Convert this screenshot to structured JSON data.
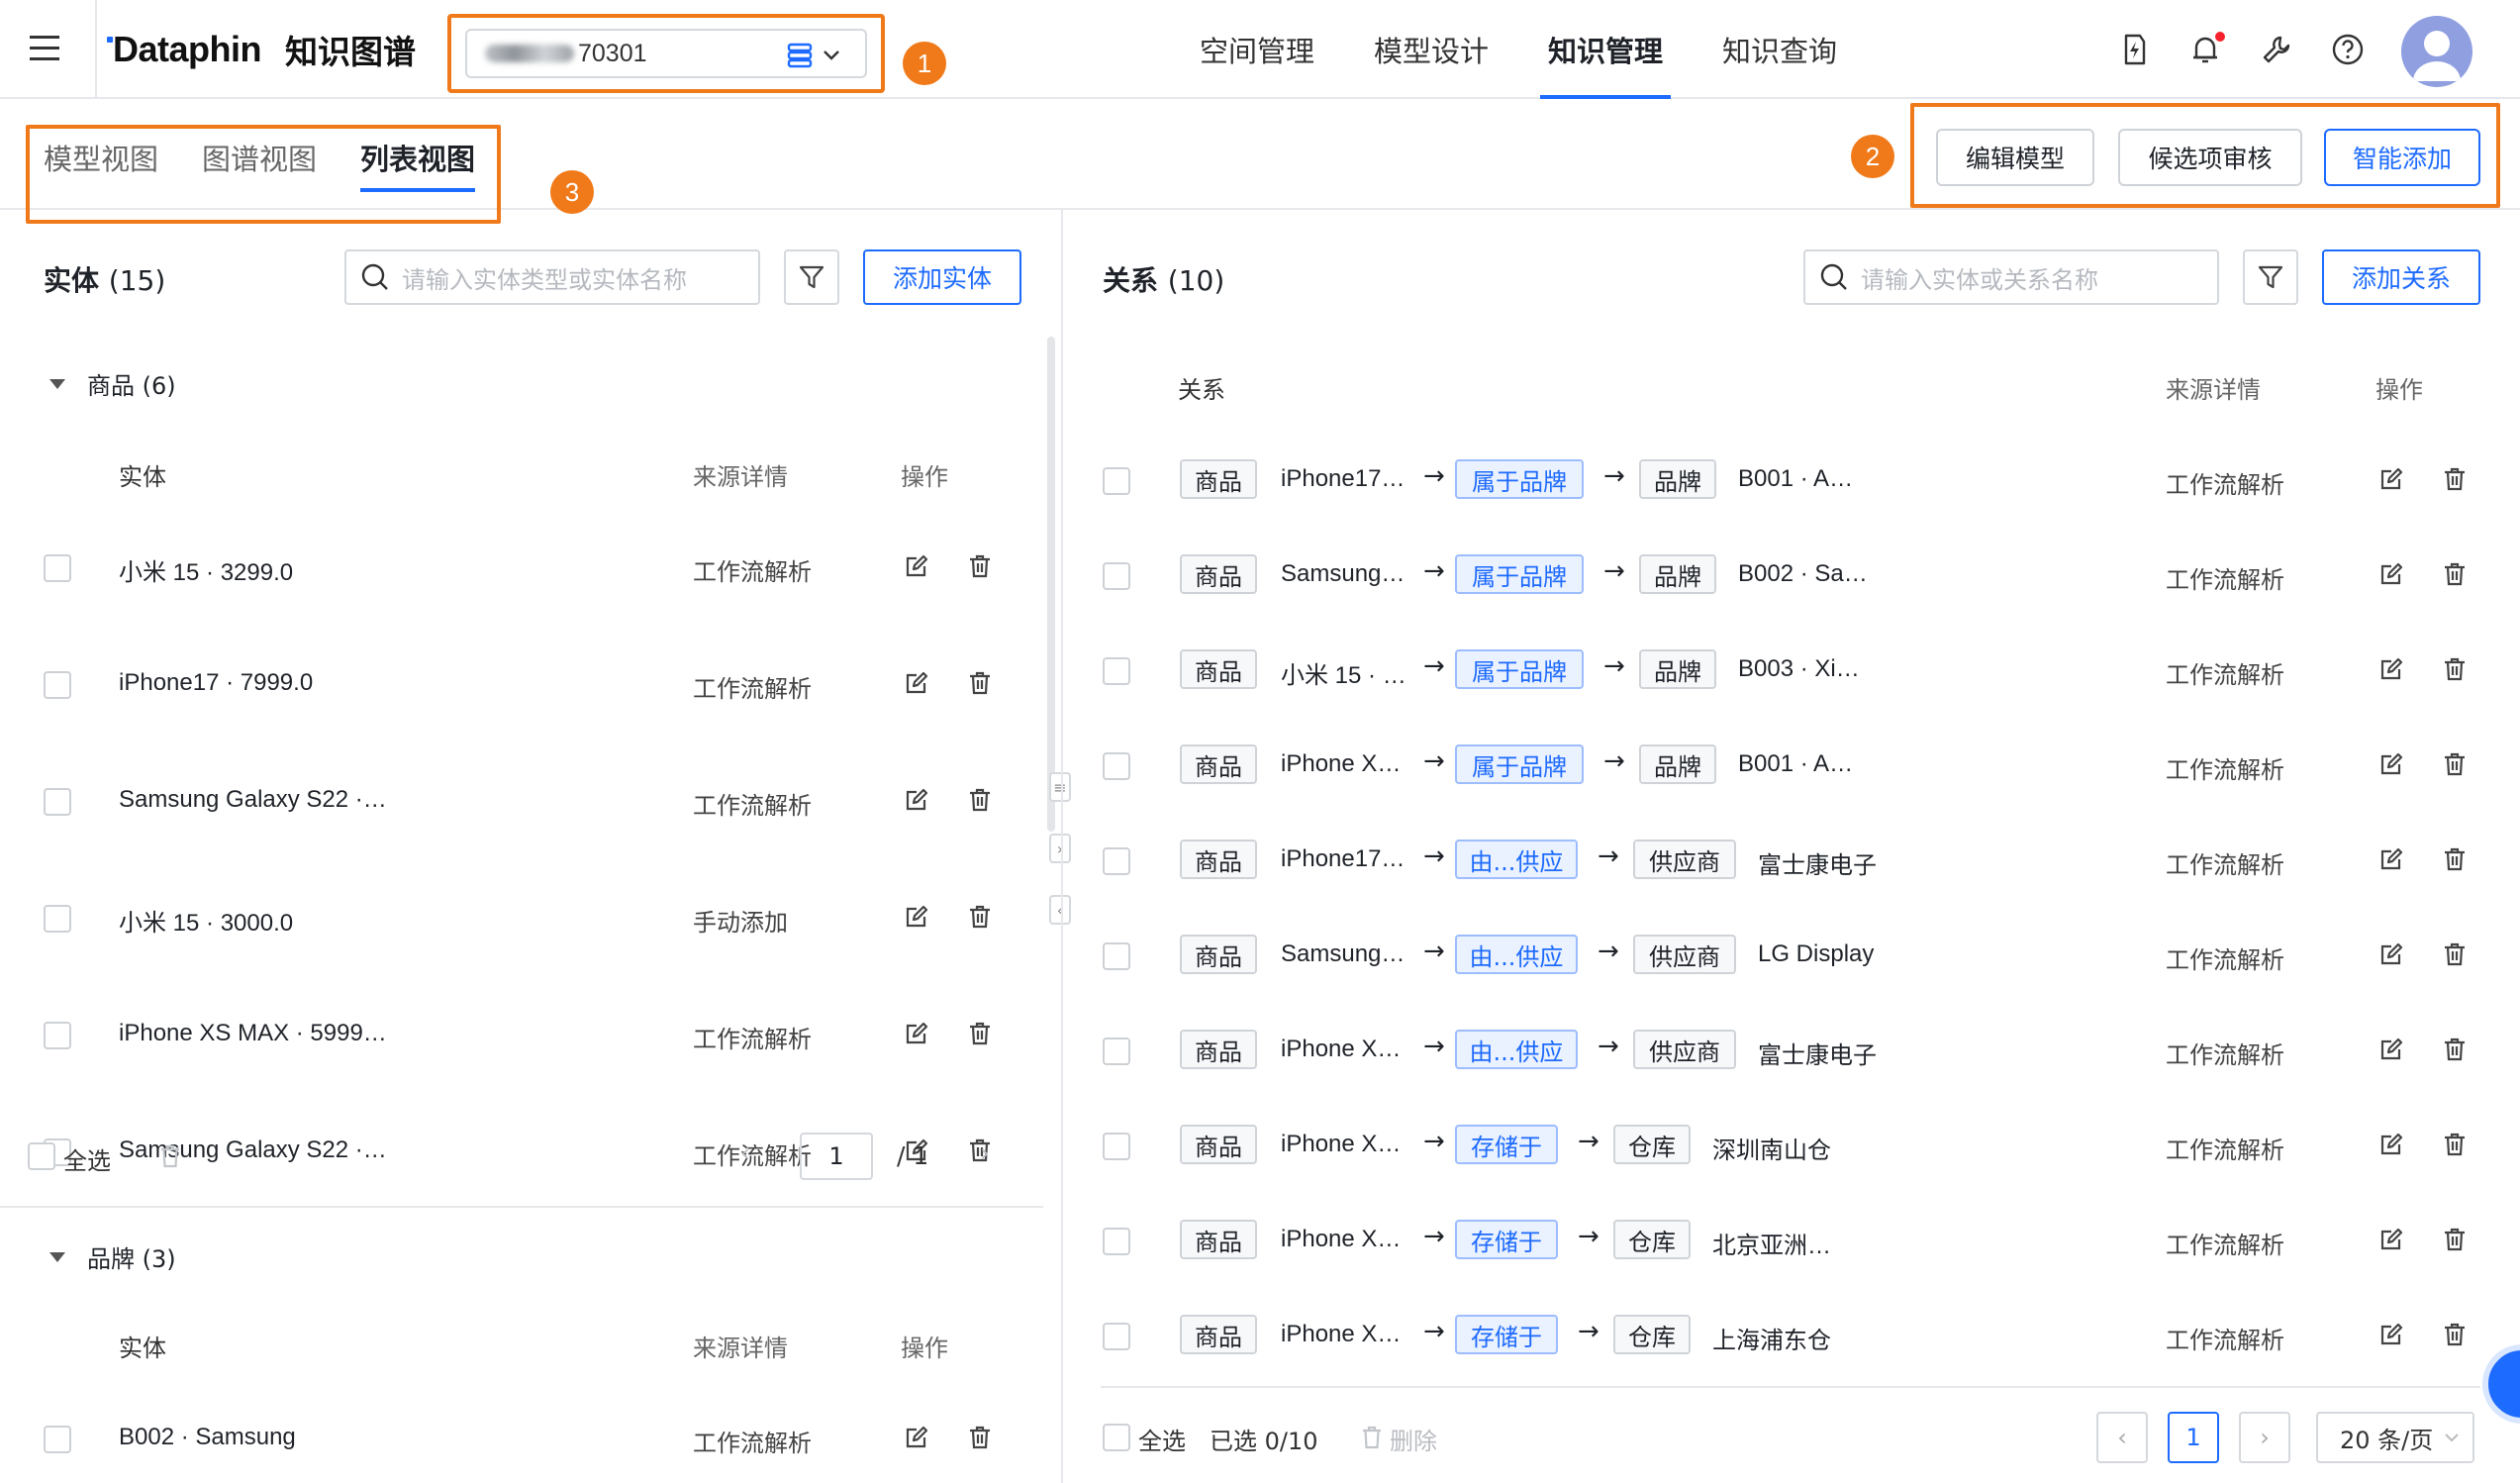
{
  "header": {
    "logo": "Dataphin",
    "product": "知识图谱",
    "project_suffix": "70301",
    "nav": [
      "空间管理",
      "模型设计",
      "知识管理",
      "知识查询"
    ],
    "active_nav": "知识管理",
    "badges": [
      "1",
      "2",
      "3"
    ],
    "icons": [
      "menu-icon",
      "bolt-icon",
      "bell-icon",
      "wrench-icon",
      "help-icon",
      "avatar"
    ]
  },
  "tabs": {
    "items": [
      "模型视图",
      "图谱视图",
      "列表视图"
    ],
    "active": "列表视图"
  },
  "actions": {
    "edit_model": "编辑模型",
    "review_candidates": "候选项审核",
    "smart_add": "智能添加"
  },
  "entities": {
    "title": "实体",
    "count": "(15)",
    "search_placeholder": "请输入实体类型或实体名称",
    "add_label": "添加实体",
    "groups": [
      {
        "name": "商品 (6)",
        "col_entity": "实体",
        "col_source": "来源详情",
        "col_ops": "操作",
        "rows": [
          {
            "name": "小米 15 · 3299.0",
            "source": "工作流解析"
          },
          {
            "name": "iPhone17 · 7999.0",
            "source": "工作流解析"
          },
          {
            "name": "Samsung Galaxy S22 ·…",
            "source": "工作流解析"
          },
          {
            "name": "小米 15 · 3000.0",
            "source": "手动添加"
          },
          {
            "name": "iPhone XS MAX · 5999…",
            "source": "工作流解析"
          },
          {
            "name": "Samsung Galaxy S22 ·…",
            "source": "工作流解析"
          }
        ],
        "select_all": "全选",
        "page": "1",
        "total": "/  1"
      },
      {
        "name": "品牌 (3)",
        "col_entity": "实体",
        "col_source": "来源详情",
        "col_ops": "操作",
        "rows": [
          {
            "name": "B002 · Samsung",
            "source": "工作流解析"
          }
        ]
      }
    ]
  },
  "relations": {
    "title": "关系",
    "count": "(10)",
    "search_placeholder": "请输入实体或关系名称",
    "add_label": "添加关系",
    "col_relation": "关系",
    "col_source": "来源详情",
    "col_ops": "操作",
    "rows": [
      {
        "src_type": "商品",
        "src": "iPhone17…",
        "rel": "属于品牌",
        "dst_type": "品牌",
        "dst": "B001 · A…",
        "source": "工作流解析"
      },
      {
        "src_type": "商品",
        "src": "Samsung…",
        "rel": "属于品牌",
        "dst_type": "品牌",
        "dst": "B002 · Sa…",
        "source": "工作流解析"
      },
      {
        "src_type": "商品",
        "src": "小米 15 · …",
        "rel": "属于品牌",
        "dst_type": "品牌",
        "dst": "B003 · Xi…",
        "source": "工作流解析"
      },
      {
        "src_type": "商品",
        "src": "iPhone X…",
        "rel": "属于品牌",
        "dst_type": "品牌",
        "dst": "B001 · A…",
        "source": "工作流解析"
      },
      {
        "src_type": "商品",
        "src": "iPhone17…",
        "rel": "由...供应",
        "dst_type": "供应商",
        "dst": "富士康电子",
        "source": "工作流解析"
      },
      {
        "src_type": "商品",
        "src": "Samsung…",
        "rel": "由...供应",
        "dst_type": "供应商",
        "dst": "LG Display",
        "source": "工作流解析"
      },
      {
        "src_type": "商品",
        "src": "iPhone X…",
        "rel": "由...供应",
        "dst_type": "供应商",
        "dst": "富士康电子",
        "source": "工作流解析"
      },
      {
        "src_type": "商品",
        "src": "iPhone X…",
        "rel": "存储于",
        "dst_type": "仓库",
        "dst": "深圳南山仓",
        "source": "工作流解析"
      },
      {
        "src_type": "商品",
        "src": "iPhone X…",
        "rel": "存储于",
        "dst_type": "仓库",
        "dst": "北京亚洲…",
        "source": "工作流解析"
      },
      {
        "src_type": "商品",
        "src": "iPhone X…",
        "rel": "存储于",
        "dst_type": "仓库",
        "dst": "上海浦东仓",
        "source": "工作流解析"
      }
    ],
    "select_all": "全选",
    "selected": "已选 0/10",
    "delete": "删除",
    "page": "1",
    "page_size": "20 条/页"
  },
  "colors": {
    "accent": "#1e6bff",
    "highlight": "#f07a1a",
    "danger": "#f5222d"
  }
}
